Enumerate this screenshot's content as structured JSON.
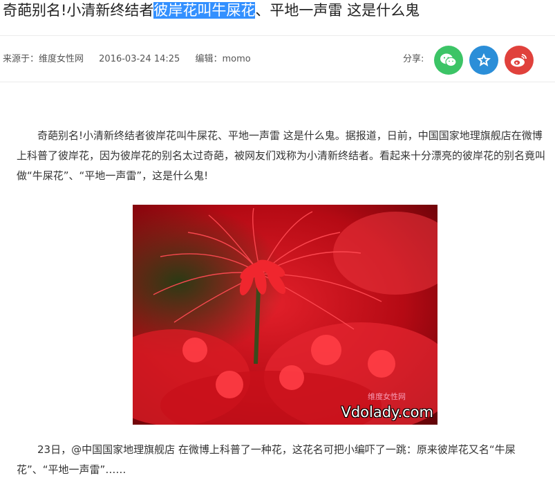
{
  "article": {
    "title_before": "奇葩别名!小清新终结者",
    "title_highlight": "彼岸花叫牛屎花",
    "title_after": "、平地一声雷 这是什么鬼"
  },
  "meta": {
    "source": "来源于：维度女性网",
    "datetime": "2016-03-24 14:25",
    "editor": "编辑：momo"
  },
  "share": {
    "label": "分享:",
    "buttons": [
      {
        "name": "wechat",
        "color": "#3cc466",
        "icon": "wechat-icon"
      },
      {
        "name": "favorite",
        "color": "#2b8ed8",
        "icon": "star-icon"
      },
      {
        "name": "weibo",
        "color": "#e0413c",
        "icon": "weibo-icon"
      }
    ]
  },
  "body": {
    "para1": "奇葩别名!小清新终结者彼岸花叫牛屎花、平地一声雷 这是什么鬼。据报道，日前，中国国家地理旗舰店在微博上科普了彼岸花，因为彼岸花的别名太过奇葩，被网友们戏称为小清新终结者。看起来十分漂亮的彼岸花的别名竟叫做“牛屎花”、“平地一声雷”，这是什么鬼!",
    "para2": "23日，@中国国家地理旗舰店 在微博上科普了一种花，这花名可把小编吓了一跳：原来彼岸花又名“牛屎花”、“平地一声雷”……",
    "image_watermark": "Vdolady.com",
    "image_watermark_cn": "维度女性网"
  }
}
